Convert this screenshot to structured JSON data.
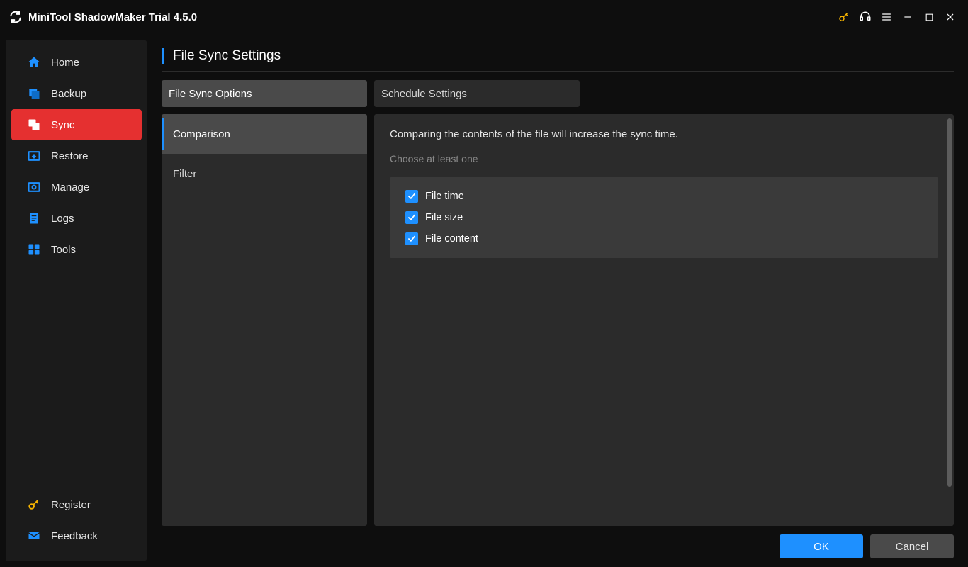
{
  "app": {
    "title": "MiniTool ShadowMaker Trial 4.5.0"
  },
  "sidebar": {
    "items": [
      {
        "label": "Home",
        "icon": "home"
      },
      {
        "label": "Backup",
        "icon": "backup"
      },
      {
        "label": "Sync",
        "icon": "sync",
        "active": true
      },
      {
        "label": "Restore",
        "icon": "restore"
      },
      {
        "label": "Manage",
        "icon": "manage"
      },
      {
        "label": "Logs",
        "icon": "logs"
      },
      {
        "label": "Tools",
        "icon": "tools"
      }
    ],
    "footer": [
      {
        "label": "Register",
        "icon": "key"
      },
      {
        "label": "Feedback",
        "icon": "mail"
      }
    ]
  },
  "page": {
    "title": "File Sync Settings",
    "tabs": [
      {
        "label": "File Sync Options",
        "active": true
      },
      {
        "label": "Schedule Settings",
        "active": false
      }
    ],
    "options": [
      {
        "label": "Comparison",
        "active": true
      },
      {
        "label": "Filter",
        "active": false
      }
    ],
    "panel": {
      "description": "Comparing the contents of the file will increase the sync time.",
      "subdescription": "Choose at least one",
      "checks": [
        {
          "label": "File time",
          "checked": true
        },
        {
          "label": "File size",
          "checked": true
        },
        {
          "label": "File content",
          "checked": true
        }
      ]
    },
    "buttons": {
      "ok": "OK",
      "cancel": "Cancel"
    }
  },
  "colors": {
    "accent": "#1e90ff",
    "danger": "#e53030",
    "key": "#f5b301"
  }
}
